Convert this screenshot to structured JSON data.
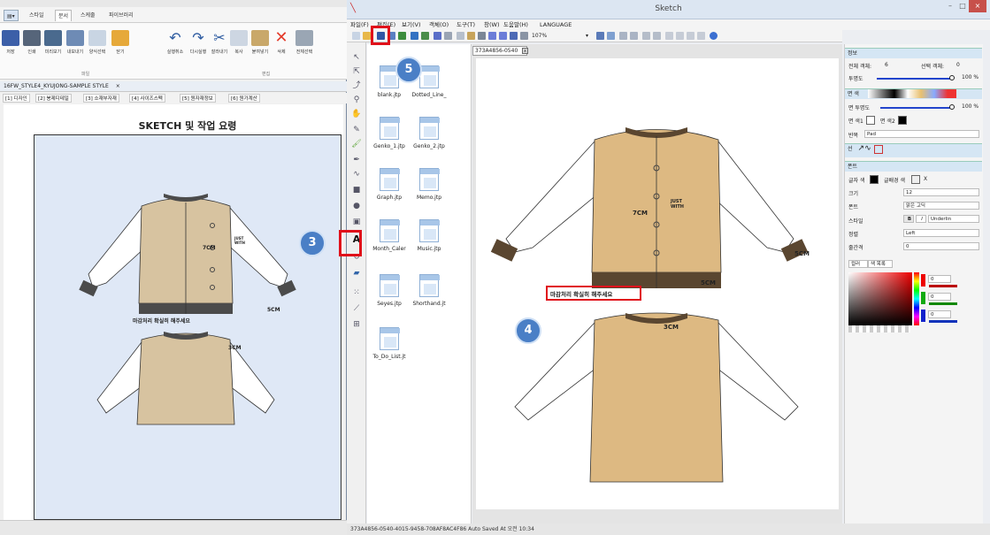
{
  "left_app": {
    "tabs": [
      "스타일",
      "문서",
      "스케줄",
      "파이브러리"
    ],
    "ribbon_buttons": [
      "저장",
      "인쇄",
      "미리보기",
      "내보내기",
      "양식선택",
      "닫기",
      "실행취소",
      "다시실행",
      "잘라내기",
      "복사",
      "붙여넣기",
      "삭제",
      "전체선택"
    ],
    "groups": [
      "파일",
      "편집"
    ],
    "doc_tab": "16FW_STYLE4_KYUJONG-SAMPLE STYLE",
    "doc_tab_close": "×",
    "subtabs": [
      "[1] 디자인",
      "[2] 봉제디테일",
      "[3] 소재부자재",
      "[4] 사이즈스펙",
      "[5] 원자재정보",
      "[6] 원가계산"
    ],
    "sheet_title": "SKETCH 및 작업 요령",
    "note": "마감처리 확실히 해주세요",
    "label_7cm": "7CM",
    "label_5cm": "5CM",
    "label_3cm": "3CM",
    "chest_text": "JUST WITH"
  },
  "sketch": {
    "title": "Sketch",
    "window_buttons": [
      "–",
      "□",
      "×"
    ],
    "menu": [
      "파일(F)",
      "편집(E)",
      "보기(V)",
      "객체(O)",
      "도구(T)",
      "창(W)",
      "도움말(H)",
      "LANGUAGE"
    ],
    "zoom": "107%",
    "files": [
      "blank.jtp",
      "Dotted_Line_",
      "Genko_1.jtp",
      "Genko_2.jtp",
      "Graph.jtp",
      "Memo.jtp",
      "Month_Caler",
      "Music.jtp",
      "Seyes.jtp",
      "Shorthand.jt",
      "To_Do_List.jt"
    ],
    "canvas_tab": "373A4856-0540",
    "canvas_tab_close": "x",
    "status": "373A4856-0540-4015-9458-708AF8AC4F86 Auto Saved At 오전 10:34",
    "canvas_note": "마감처리 확실히 해주세요",
    "label_7cm": "7CM",
    "label_5cm": "5CM",
    "label_3cm": "3CM",
    "chest_text": "JUST WITH"
  },
  "props": {
    "info_header": "정보",
    "total_objects_label": "전체 객체:",
    "total_objects": "6",
    "selected_objects_label": "선택 객체:",
    "selected_objects": "0",
    "opacity_label": "투명도",
    "opacity": "100 %",
    "fill_header": "면 색",
    "fill_opacity_label": "면 투명도",
    "fill_opacity": "100 %",
    "fill_color1": "면 색1",
    "fill_color2": "면 색2",
    "repeat_label": "반복",
    "repeat_value": "Pad",
    "line_header": "선",
    "font_header": "폰트",
    "text_color_label": "글자 색",
    "bg_color_label": "글배경 색",
    "bg_x": "X",
    "size_label": "크기",
    "size_value": "12",
    "font_label": "폰트",
    "font_value": "맑은 고딕",
    "style_label": "스타일",
    "bold": "B",
    "italic": "I",
    "underline": "Underlin",
    "align_label": "정렬",
    "align_value": "Left",
    "spacing_label": "줄간격",
    "spacing_value": "0",
    "color_tabs": [
      "컬러",
      "색 목록"
    ],
    "rgb": [
      "0",
      "0",
      "0"
    ]
  },
  "callouts": [
    "3",
    "4",
    "5"
  ],
  "colors": {
    "accent": "#4a7fc6",
    "highlight": "#e0101a",
    "jacket_body": "#ddb982",
    "trim": "#5a4630"
  }
}
